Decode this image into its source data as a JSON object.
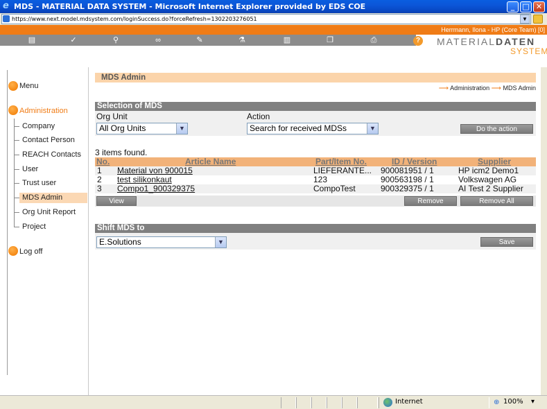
{
  "window": {
    "title": "MDS - MATERIAL DATA SYSTEM - Microsoft Internet Explorer provided by EDS COE",
    "address": "https://www.next.model.mdsystem.com/loginSuccess.do?forceRefresh=1302203276051"
  },
  "userbar": {
    "text": "Herrmann, Ilona  -  HP (Core Team) [0]"
  },
  "brand": {
    "line1_a": "MATERIAL",
    "line1_b": "DATEN",
    "line2": "SYSTEM"
  },
  "nav": {
    "menu": "Menu",
    "administration": "Administration",
    "items": [
      "Company",
      "Contact Person",
      "REACH Contacts",
      "User",
      "Trust user",
      "MDS Admin",
      "Org Unit Report",
      "Project"
    ],
    "logoff": "Log off"
  },
  "page": {
    "title": "MDS Admin",
    "breadcrumb": [
      "Administration",
      "MDS Admin"
    ]
  },
  "selection": {
    "heading": "Selection of MDS",
    "org_unit_label": "Org Unit",
    "org_unit_value": "All Org Units",
    "action_label": "Action",
    "action_value": "Search for received MDSs",
    "do_action": "Do the action"
  },
  "results": {
    "count_text": "3 items found.",
    "headers": {
      "no": "No.",
      "article": "Article Name",
      "part": "Part/Item No.",
      "id": "ID / Version",
      "supplier": "Supplier"
    },
    "rows": [
      {
        "no": "1",
        "article": "Material von 900015",
        "part": "LIEFERANTE...",
        "id": "900081951 / 1",
        "supplier": "HP icm2 Demo1"
      },
      {
        "no": "2",
        "article": "test silikonkaut",
        "part": "123",
        "id": "900563198 / 1",
        "supplier": "Volkswagen AG"
      },
      {
        "no": "3",
        "article": "Compo1_900329375",
        "part": "CompoTest",
        "id": "900329375 / 1",
        "supplier": "AI Test 2 Supplier"
      }
    ],
    "view": "View",
    "remove": "Remove",
    "remove_all": "Remove All"
  },
  "shift": {
    "heading": "Shift MDS to",
    "value": "E.Solutions",
    "save": "Save"
  },
  "status": {
    "zone": "Internet",
    "zoom": "100%"
  }
}
